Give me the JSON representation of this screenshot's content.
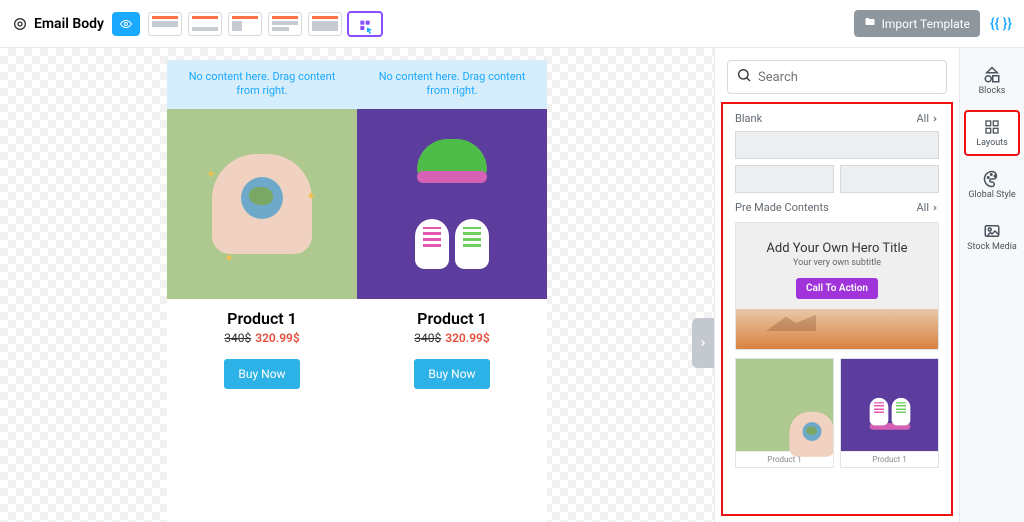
{
  "header": {
    "title": "Email Body",
    "import_label": "Import Template"
  },
  "canvas": {
    "drag_notice": "No content here. Drag content from right.",
    "products": [
      {
        "title": "Product 1",
        "old_price": "340$",
        "new_price": "320.99$",
        "buy_label": "Buy Now"
      },
      {
        "title": "Product 1",
        "old_price": "340$",
        "new_price": "320.99$",
        "buy_label": "Buy Now"
      }
    ]
  },
  "panel": {
    "search_placeholder": "Search",
    "blank_label": "Blank",
    "all_label": "All",
    "premade_label": "Pre Made Contents",
    "hero": {
      "title": "Add Your Own Hero Title",
      "subtitle": "Your very own subtitle",
      "cta": "Call To Action"
    },
    "mini_product_label": "Product 1"
  },
  "tabs": {
    "blocks": "Blocks",
    "layouts": "Layouts",
    "global_style": "Global Style",
    "stock_media": "Stock Media"
  }
}
